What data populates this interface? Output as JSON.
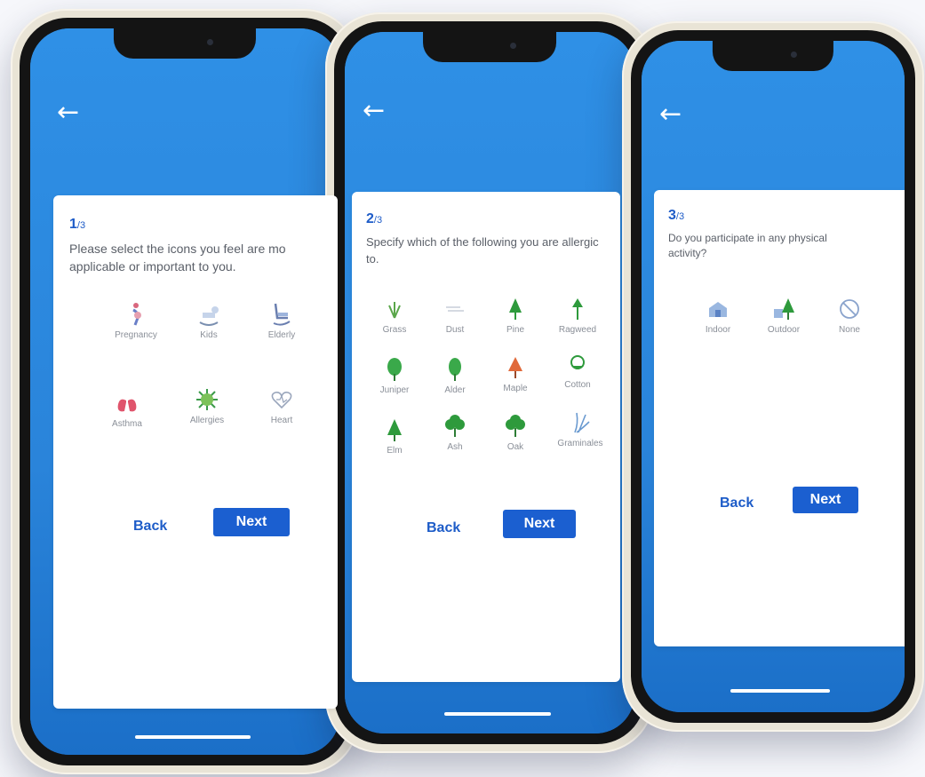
{
  "colors": {
    "accent": "#1b5fd0",
    "sky": "#2a86dc",
    "card": "#ffffff"
  },
  "screens": [
    {
      "step_num": "1",
      "step_total": "/3",
      "question": "Please select the icons you feel are mo applicable or important to you.",
      "back_label": "Back",
      "next_label": "Next",
      "options": [
        {
          "label": "Pregnancy",
          "icon": "pregnancy-icon"
        },
        {
          "label": "Kids",
          "icon": "rocking-horse-icon"
        },
        {
          "label": "Elderly",
          "icon": "rocking-chair-icon"
        },
        {
          "label": "Asthma",
          "icon": "lungs-icon"
        },
        {
          "label": "Allergies",
          "icon": "virus-icon"
        },
        {
          "label": "Heart",
          "icon": "heart-icon"
        }
      ]
    },
    {
      "step_num": "2",
      "step_total": "/3",
      "question": "Specify which of the following you are allergic to.",
      "back_label": "Back",
      "next_label": "Next",
      "options": [
        {
          "label": "Grass",
          "icon": "grass-icon"
        },
        {
          "label": "Dust",
          "icon": "dust-icon"
        },
        {
          "label": "Pine",
          "icon": "pine-tree-icon"
        },
        {
          "label": "Ragweed",
          "icon": "ragweed-icon"
        },
        {
          "label": "Juniper",
          "icon": "juniper-tree-icon"
        },
        {
          "label": "Alder",
          "icon": "alder-tree-icon"
        },
        {
          "label": "Maple",
          "icon": "maple-tree-icon"
        },
        {
          "label": "Cotton",
          "icon": "cotton-icon"
        },
        {
          "label": "Elm",
          "icon": "elm-tree-icon"
        },
        {
          "label": "Ash",
          "icon": "ash-tree-icon"
        },
        {
          "label": "Oak",
          "icon": "oak-tree-icon"
        },
        {
          "label": "Graminales",
          "icon": "graminales-icon"
        }
      ]
    },
    {
      "step_num": "3",
      "step_total": "/3",
      "question": "Do you participate in any physical activity?",
      "back_label": "Back",
      "next_label": "Next",
      "options": [
        {
          "label": "Indoor",
          "icon": "indoor-icon"
        },
        {
          "label": "Outdoor",
          "icon": "outdoor-icon"
        },
        {
          "label": "None",
          "icon": "none-icon"
        }
      ]
    }
  ]
}
